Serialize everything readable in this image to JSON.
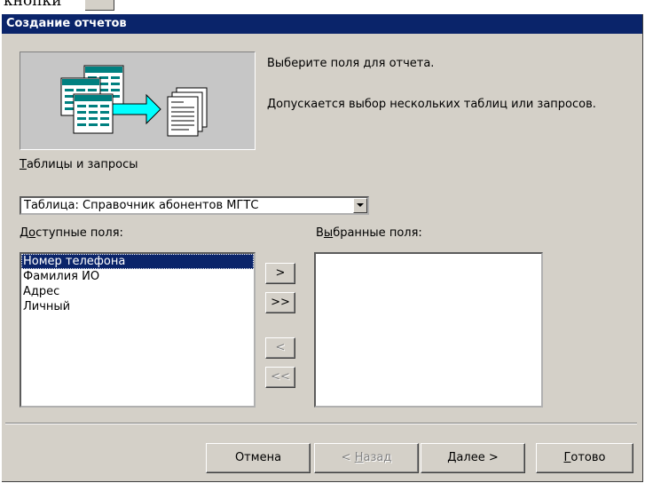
{
  "page_fragment": "кнопки",
  "dialog": {
    "title": "Создание отчетов",
    "instruction_line1": "Выберите поля для отчета.",
    "instruction_line2": "Допускается выбор нескольких таблиц или запросов.",
    "tables_label": {
      "accel": "Т",
      "rest": "аблицы и запросы"
    },
    "tables_value": "Таблица: Справочник абонентов МГТС",
    "available_label": {
      "pre": "Д",
      "accel": "о",
      "rest": "ступные поля:"
    },
    "selected_label": {
      "pre": "В",
      "accel": "ы",
      "rest": "бранные поля:"
    },
    "available_fields": [
      "Номер телефона",
      "Фамилия ИО",
      "Адрес",
      "Личный"
    ],
    "selected_index": 0,
    "selected_fields": [],
    "move_buttons": {
      "add_one": ">",
      "add_all": ">>",
      "remove_one": "<",
      "remove_all": "<<"
    },
    "buttons": {
      "cancel": "Отмена",
      "back": {
        "pre": "< ",
        "accel": "Н",
        "rest": "азад"
      },
      "next": {
        "accel": "Д",
        "rest": "алее >"
      },
      "finish": {
        "accel": "Г",
        "rest": "отово"
      }
    },
    "colors": {
      "titlebar": "#0a246a",
      "face": "#d4d0c8",
      "selection": "#0a246a",
      "illustration_arrow": "#00ffff",
      "illustration_table": "#008080"
    },
    "icons": [
      "tables-illustration-icon",
      "arrow-right-icon",
      "report-pages-icon",
      "dropdown-arrow-icon"
    ]
  }
}
